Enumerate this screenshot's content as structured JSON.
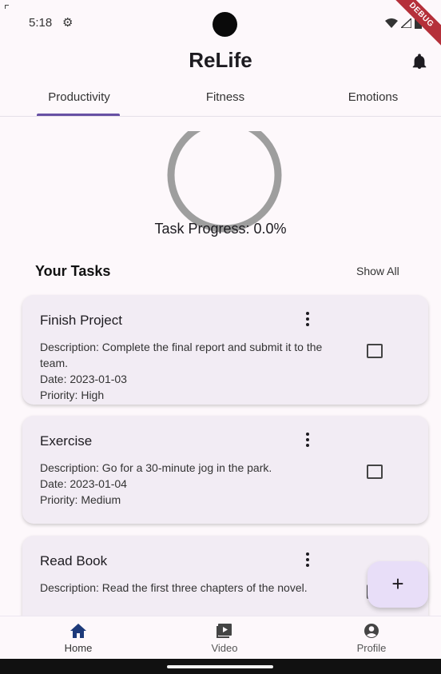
{
  "status_bar": {
    "time": "5:18",
    "debug_banner": "DEBUG"
  },
  "app_bar": {
    "title": "ReLife"
  },
  "tabs": [
    {
      "label": "Productivity",
      "selected": true
    },
    {
      "label": "Fitness",
      "selected": false
    },
    {
      "label": "Emotions",
      "selected": false
    }
  ],
  "progress": {
    "label": "Task Progress: 0.0%",
    "value": 0.0
  },
  "tasks_section": {
    "title": "Your Tasks",
    "show_all": "Show All"
  },
  "tasks": [
    {
      "title": "Finish Project",
      "description": "Description: Complete the final report and submit it to the team.",
      "date": "Date: 2023-01-03",
      "priority": "Priority: High",
      "checked": false
    },
    {
      "title": "Exercise",
      "description": "Description: Go for a 30-minute jog in the park.",
      "date": "Date: 2023-01-04",
      "priority": "Priority: Medium",
      "checked": false
    },
    {
      "title": "Read Book",
      "description": "Description: Read the first three chapters of the novel.",
      "checked": false
    }
  ],
  "fab": {
    "label": "+"
  },
  "bottom_nav": [
    {
      "label": "Home",
      "icon": "home-icon",
      "selected": true
    },
    {
      "label": "Video",
      "icon": "video-icon",
      "selected": false
    },
    {
      "label": "Profile",
      "icon": "profile-icon",
      "selected": false
    }
  ],
  "colors": {
    "accent": "#6750a4",
    "background": "#fdf8fb",
    "card": "#f2ecf4",
    "fab": "#e8def8",
    "progress_track": "#9e9e9e"
  }
}
